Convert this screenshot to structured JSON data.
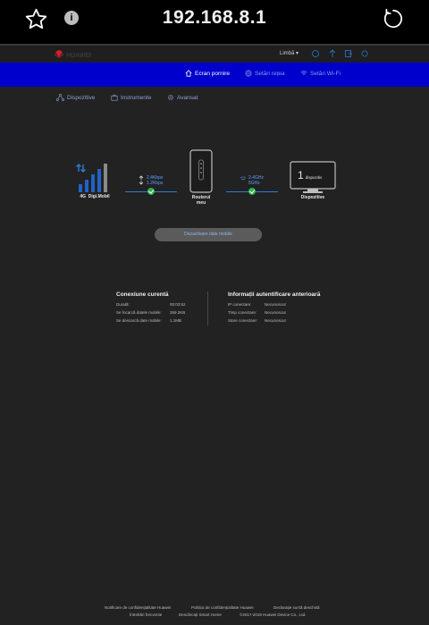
{
  "browser": {
    "url": "192.168.8.1",
    "info_glyph": "i"
  },
  "topbar": {
    "brand": "HUAWEI",
    "language_label": "Limbă ▾"
  },
  "nav": {
    "home": "Ecran pornire",
    "network": "Setări rețea",
    "wifi": "Setări Wi-Fi"
  },
  "subnav": {
    "devices": "Dispozitive",
    "tools": "Instrumente",
    "advanced": "Avansat"
  },
  "diagram": {
    "network_type": "4G",
    "operator": "Digi.Mobil",
    "upload_speed": "2.4Kbps",
    "download_speed": "1.2Kbps",
    "router_label_line1": "Routerul",
    "router_label_line2": "meu",
    "wifi_band_24": "2.4GHz",
    "wifi_band_5": "5GHz",
    "device_count": "1",
    "device_count_unit": "dispozitiv",
    "devices_label": "Dispozitive",
    "signal_strength": 5
  },
  "mobile_data_button": "Dezactivare date mobile",
  "current_connection": {
    "title": "Conexiune curentă",
    "rows": [
      {
        "label": "Durată:",
        "value": "00:03:52"
      },
      {
        "label": "Se încarcă datele mobile:",
        "value": "359.2KB"
      },
      {
        "label": "Se descarcă date mobile:",
        "value": "1.1MB"
      }
    ]
  },
  "previous_auth": {
    "title": "Informații autentificare anterioară",
    "rows": [
      {
        "label": "IP conectare:",
        "value": "Necunoscut"
      },
      {
        "label": "Timp conectare:",
        "value": "Necunoscut"
      },
      {
        "label": "Stare conectare:",
        "value": "Necunoscut"
      }
    ]
  },
  "footer": {
    "privacy_huawei": "Notificare de confidențialitate Huawei",
    "privacy_policy": "Politica de confidențialitate Huawei",
    "open_source": "Declarație sursă deschisă",
    "faq": "Întrebări frecvente",
    "smart_home": "Descărcați Smart Home",
    "copyright": "©2017-2019 Huawei Device Co., Ltd."
  },
  "colors": {
    "nav_bg": "#0000cc",
    "accent": "#2e7cd6",
    "ok": "#2fb34a",
    "page_bg": "#222222"
  }
}
